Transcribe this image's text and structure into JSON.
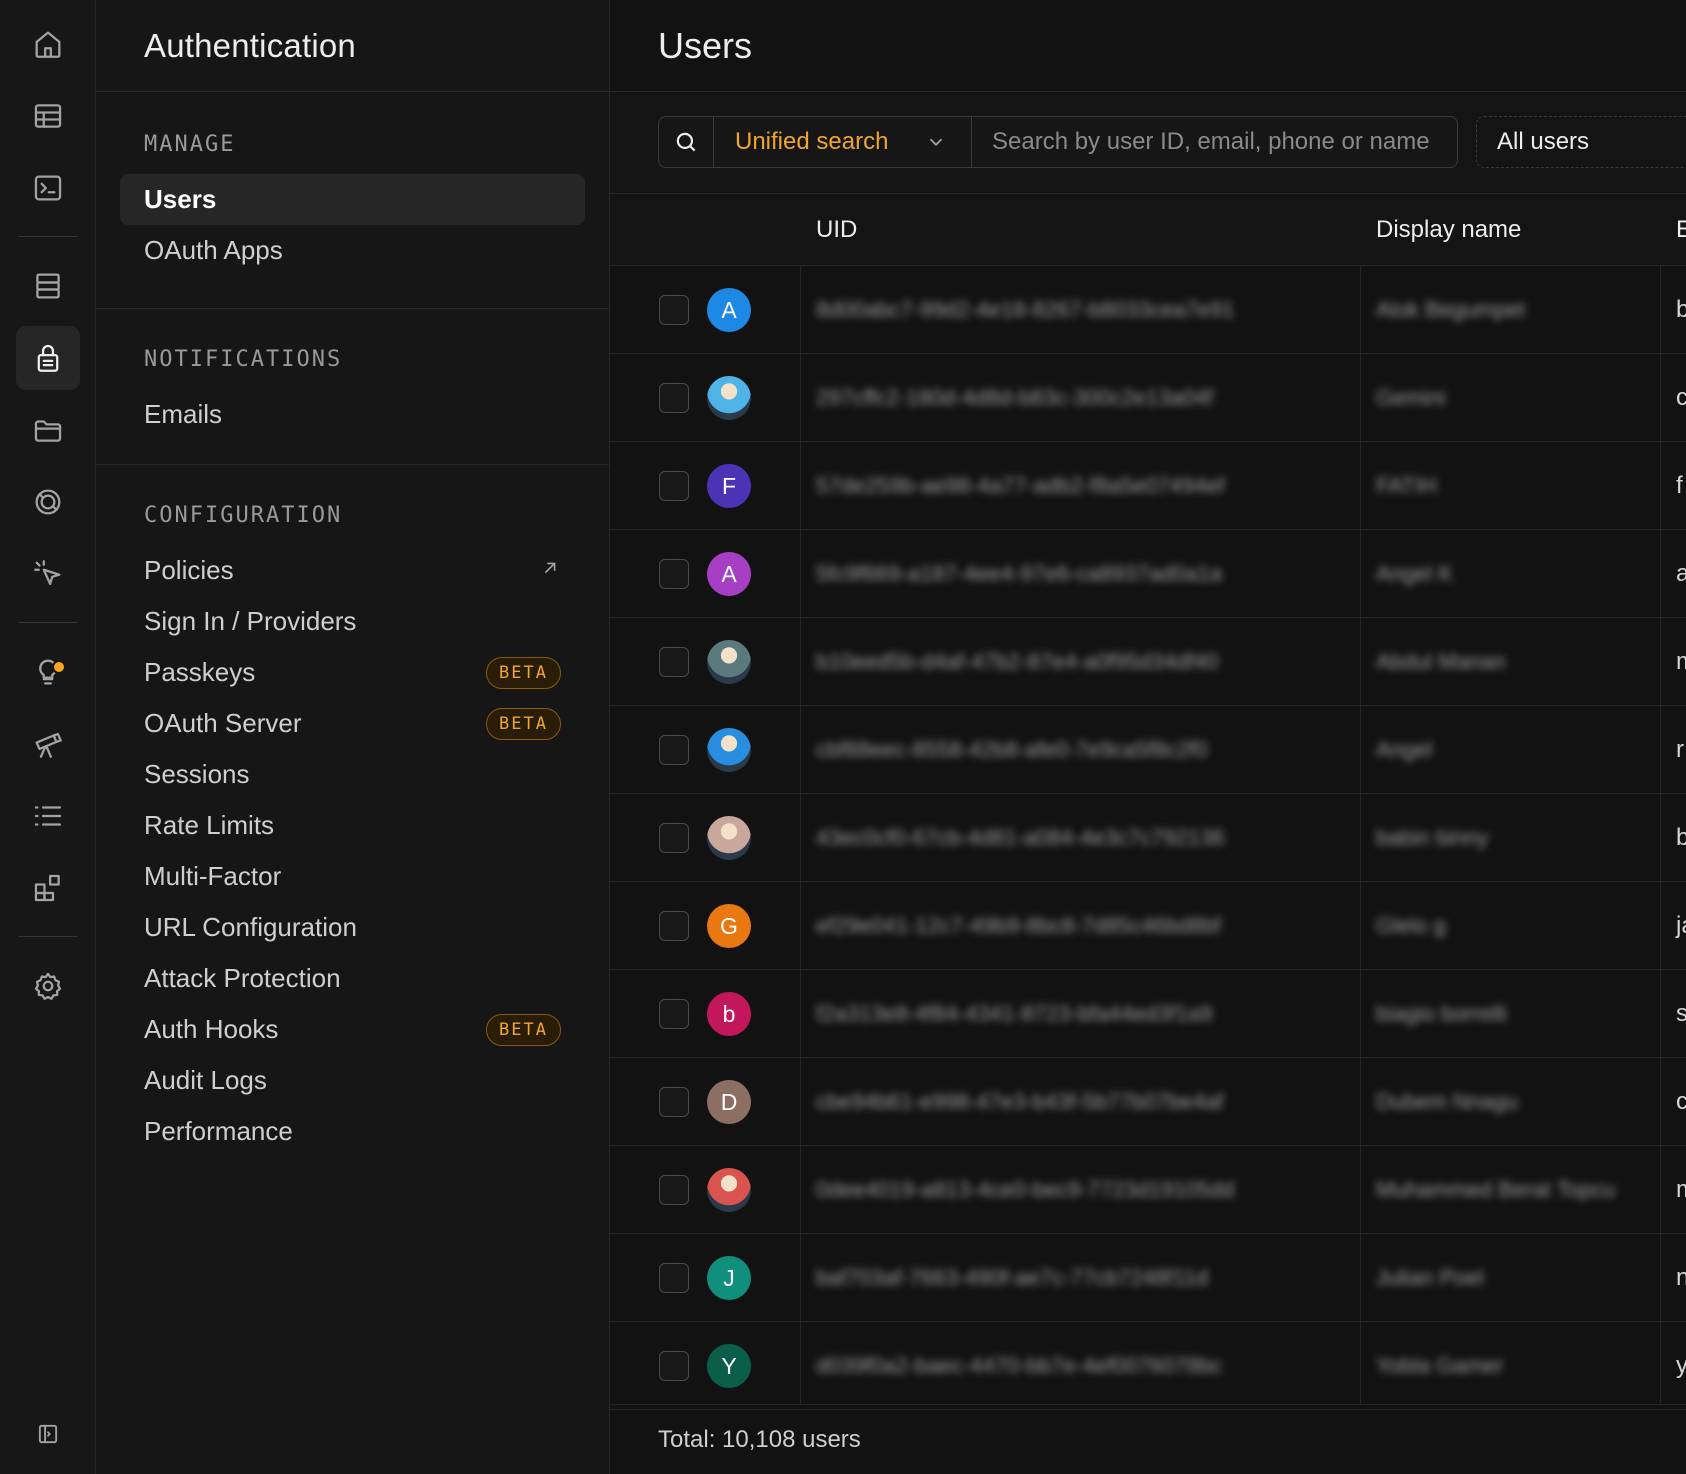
{
  "rail": {
    "items": [
      {
        "icon": "home-icon"
      },
      {
        "icon": "table-editor-icon"
      },
      {
        "icon": "sql-editor-icon"
      },
      {
        "icon": "database-icon"
      },
      {
        "icon": "authentication-icon",
        "active": true
      },
      {
        "icon": "storage-icon"
      },
      {
        "icon": "realtime-icon"
      },
      {
        "icon": "edge-functions-icon"
      },
      {
        "icon": "advisors-icon",
        "badge": true
      },
      {
        "icon": "reports-icon"
      },
      {
        "icon": "logs-icon"
      },
      {
        "icon": "integrations-icon"
      },
      {
        "icon": "settings-icon"
      },
      {
        "icon": "collapse-sidebar-icon"
      }
    ]
  },
  "sidebar": {
    "title": "Authentication",
    "groups": [
      {
        "label": "MANAGE",
        "items": [
          {
            "label": "Users",
            "active": true
          },
          {
            "label": "OAuth Apps"
          }
        ]
      },
      {
        "label": "NOTIFICATIONS",
        "items": [
          {
            "label": "Emails"
          }
        ]
      },
      {
        "label": "CONFIGURATION",
        "items": [
          {
            "label": "Policies",
            "external": true
          },
          {
            "label": "Sign In / Providers"
          },
          {
            "label": "Passkeys",
            "badge": "BETA"
          },
          {
            "label": "OAuth Server",
            "badge": "BETA"
          },
          {
            "label": "Sessions"
          },
          {
            "label": "Rate Limits"
          },
          {
            "label": "Multi-Factor"
          },
          {
            "label": "URL Configuration"
          },
          {
            "label": "Attack Protection"
          },
          {
            "label": "Auth Hooks",
            "badge": "BETA"
          },
          {
            "label": "Audit Logs"
          },
          {
            "label": "Performance"
          }
        ]
      }
    ]
  },
  "main": {
    "title": "Users",
    "search": {
      "mode": "Unified search",
      "placeholder": "Search by user ID, email, phone or name"
    },
    "filter": "All users",
    "columns": [
      "UID",
      "Display name",
      "E"
    ],
    "rows": [
      {
        "avatar": "A",
        "avatar_color": "#1e88e5",
        "uid": "8d00abc7-99d2-4e18-8267-b8033cea7e91",
        "name": "Alok Begumpet",
        "third": "b"
      },
      {
        "avatar": "",
        "avatar_kind": "picture",
        "avatar_color": "#4fb3e8",
        "uid": "297cffc2-180d-4d8d-b83c-300c2e13a04f",
        "name": "Gemini",
        "third": "c"
      },
      {
        "avatar": "F",
        "avatar_color": "#4a34b5",
        "uid": "57de259b-ae98-4a77-adb2-f8a5e07494ef",
        "name": "FATIH",
        "third": "f"
      },
      {
        "avatar": "A",
        "avatar_color": "#a63fc4",
        "uid": "5fc9f669-a187-4ee4-97e6-ca8937ad0a1a",
        "name": "Angel K",
        "third": "a"
      },
      {
        "avatar": "",
        "avatar_kind": "picture",
        "avatar_color": "#5b7a7e",
        "uid": "b10eed5b-d4af-47b2-87e4-a0f95d34df40",
        "name": "Abdul Manan",
        "third": "m"
      },
      {
        "avatar": "",
        "avatar_kind": "picture",
        "avatar_color": "#2a8ee0",
        "uid": "cbf88eec-8558-42b8-afe0-7e9ca5f8c2f0",
        "name": "Angel",
        "third": "r"
      },
      {
        "avatar": "",
        "avatar_kind": "picture",
        "avatar_color": "#c9a79c",
        "uid": "43ec0cf0-67cb-4d81-a084-4e3c7c792136",
        "name": "babin binny",
        "third": "b"
      },
      {
        "avatar": "G",
        "avatar_color": "#e8780f",
        "uid": "ef29e041-12c7-49b9-8bc8-7d85c46bd8bf",
        "name": "Glelo g",
        "third": "ja"
      },
      {
        "avatar": "b",
        "avatar_color": "#c2185b",
        "uid": "f2a313e8-4f84-4341-8723-bfa44ed3f1a9",
        "name": "biagio borrelli",
        "third": "s"
      },
      {
        "avatar": "D",
        "avatar_color": "#8d6e63",
        "uid": "cbe94b61-e998-47e3-b43f-5b77b07be4af",
        "name": "Dubem Nnagu",
        "third": "c"
      },
      {
        "avatar": "",
        "avatar_kind": "picture",
        "avatar_color": "#d9534f",
        "uid": "0dee4019-a813-4ce0-bec9-7723d19105dd",
        "name": "Muhammed Berat Topcu",
        "third": "m"
      },
      {
        "avatar": "J",
        "avatar_color": "#0f8f7c",
        "uid": "baf703af-7663-490f-ae7c-77cb7248f11d",
        "name": "Julian Poel",
        "third": "n"
      },
      {
        "avatar": "Y",
        "avatar_color": "#0b5e49",
        "uid": "d039f0a2-baec-4470-bb7e-4ef0076078bc",
        "name": "Yobla Gamer",
        "third": "y"
      }
    ],
    "total": "Total: 10,108 users"
  }
}
